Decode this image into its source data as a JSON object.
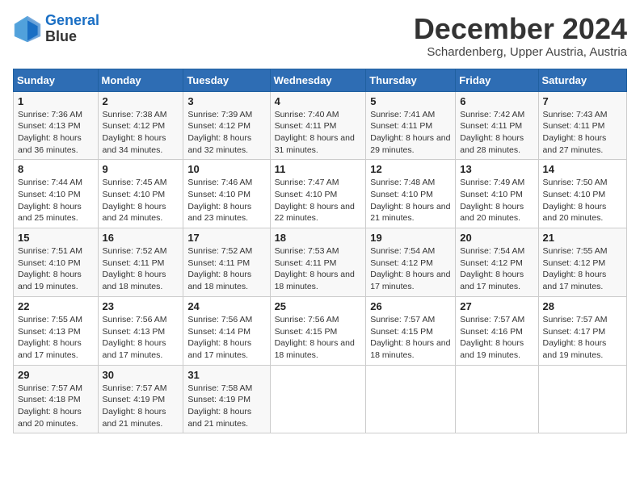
{
  "logo": {
    "line1": "General",
    "line2": "Blue"
  },
  "title": "December 2024",
  "subtitle": "Schardenberg, Upper Austria, Austria",
  "days_of_week": [
    "Sunday",
    "Monday",
    "Tuesday",
    "Wednesday",
    "Thursday",
    "Friday",
    "Saturday"
  ],
  "weeks": [
    [
      {
        "day": "1",
        "sunrise": "Sunrise: 7:36 AM",
        "sunset": "Sunset: 4:13 PM",
        "daylight": "Daylight: 8 hours and 36 minutes."
      },
      {
        "day": "2",
        "sunrise": "Sunrise: 7:38 AM",
        "sunset": "Sunset: 4:12 PM",
        "daylight": "Daylight: 8 hours and 34 minutes."
      },
      {
        "day": "3",
        "sunrise": "Sunrise: 7:39 AM",
        "sunset": "Sunset: 4:12 PM",
        "daylight": "Daylight: 8 hours and 32 minutes."
      },
      {
        "day": "4",
        "sunrise": "Sunrise: 7:40 AM",
        "sunset": "Sunset: 4:11 PM",
        "daylight": "Daylight: 8 hours and 31 minutes."
      },
      {
        "day": "5",
        "sunrise": "Sunrise: 7:41 AM",
        "sunset": "Sunset: 4:11 PM",
        "daylight": "Daylight: 8 hours and 29 minutes."
      },
      {
        "day": "6",
        "sunrise": "Sunrise: 7:42 AM",
        "sunset": "Sunset: 4:11 PM",
        "daylight": "Daylight: 8 hours and 28 minutes."
      },
      {
        "day": "7",
        "sunrise": "Sunrise: 7:43 AM",
        "sunset": "Sunset: 4:11 PM",
        "daylight": "Daylight: 8 hours and 27 minutes."
      }
    ],
    [
      {
        "day": "8",
        "sunrise": "Sunrise: 7:44 AM",
        "sunset": "Sunset: 4:10 PM",
        "daylight": "Daylight: 8 hours and 25 minutes."
      },
      {
        "day": "9",
        "sunrise": "Sunrise: 7:45 AM",
        "sunset": "Sunset: 4:10 PM",
        "daylight": "Daylight: 8 hours and 24 minutes."
      },
      {
        "day": "10",
        "sunrise": "Sunrise: 7:46 AM",
        "sunset": "Sunset: 4:10 PM",
        "daylight": "Daylight: 8 hours and 23 minutes."
      },
      {
        "day": "11",
        "sunrise": "Sunrise: 7:47 AM",
        "sunset": "Sunset: 4:10 PM",
        "daylight": "Daylight: 8 hours and 22 minutes."
      },
      {
        "day": "12",
        "sunrise": "Sunrise: 7:48 AM",
        "sunset": "Sunset: 4:10 PM",
        "daylight": "Daylight: 8 hours and 21 minutes."
      },
      {
        "day": "13",
        "sunrise": "Sunrise: 7:49 AM",
        "sunset": "Sunset: 4:10 PM",
        "daylight": "Daylight: 8 hours and 20 minutes."
      },
      {
        "day": "14",
        "sunrise": "Sunrise: 7:50 AM",
        "sunset": "Sunset: 4:10 PM",
        "daylight": "Daylight: 8 hours and 20 minutes."
      }
    ],
    [
      {
        "day": "15",
        "sunrise": "Sunrise: 7:51 AM",
        "sunset": "Sunset: 4:10 PM",
        "daylight": "Daylight: 8 hours and 19 minutes."
      },
      {
        "day": "16",
        "sunrise": "Sunrise: 7:52 AM",
        "sunset": "Sunset: 4:11 PM",
        "daylight": "Daylight: 8 hours and 18 minutes."
      },
      {
        "day": "17",
        "sunrise": "Sunrise: 7:52 AM",
        "sunset": "Sunset: 4:11 PM",
        "daylight": "Daylight: 8 hours and 18 minutes."
      },
      {
        "day": "18",
        "sunrise": "Sunrise: 7:53 AM",
        "sunset": "Sunset: 4:11 PM",
        "daylight": "Daylight: 8 hours and 18 minutes."
      },
      {
        "day": "19",
        "sunrise": "Sunrise: 7:54 AM",
        "sunset": "Sunset: 4:12 PM",
        "daylight": "Daylight: 8 hours and 17 minutes."
      },
      {
        "day": "20",
        "sunrise": "Sunrise: 7:54 AM",
        "sunset": "Sunset: 4:12 PM",
        "daylight": "Daylight: 8 hours and 17 minutes."
      },
      {
        "day": "21",
        "sunrise": "Sunrise: 7:55 AM",
        "sunset": "Sunset: 4:12 PM",
        "daylight": "Daylight: 8 hours and 17 minutes."
      }
    ],
    [
      {
        "day": "22",
        "sunrise": "Sunrise: 7:55 AM",
        "sunset": "Sunset: 4:13 PM",
        "daylight": "Daylight: 8 hours and 17 minutes."
      },
      {
        "day": "23",
        "sunrise": "Sunrise: 7:56 AM",
        "sunset": "Sunset: 4:13 PM",
        "daylight": "Daylight: 8 hours and 17 minutes."
      },
      {
        "day": "24",
        "sunrise": "Sunrise: 7:56 AM",
        "sunset": "Sunset: 4:14 PM",
        "daylight": "Daylight: 8 hours and 17 minutes."
      },
      {
        "day": "25",
        "sunrise": "Sunrise: 7:56 AM",
        "sunset": "Sunset: 4:15 PM",
        "daylight": "Daylight: 8 hours and 18 minutes."
      },
      {
        "day": "26",
        "sunrise": "Sunrise: 7:57 AM",
        "sunset": "Sunset: 4:15 PM",
        "daylight": "Daylight: 8 hours and 18 minutes."
      },
      {
        "day": "27",
        "sunrise": "Sunrise: 7:57 AM",
        "sunset": "Sunset: 4:16 PM",
        "daylight": "Daylight: 8 hours and 19 minutes."
      },
      {
        "day": "28",
        "sunrise": "Sunrise: 7:57 AM",
        "sunset": "Sunset: 4:17 PM",
        "daylight": "Daylight: 8 hours and 19 minutes."
      }
    ],
    [
      {
        "day": "29",
        "sunrise": "Sunrise: 7:57 AM",
        "sunset": "Sunset: 4:18 PM",
        "daylight": "Daylight: 8 hours and 20 minutes."
      },
      {
        "day": "30",
        "sunrise": "Sunrise: 7:57 AM",
        "sunset": "Sunset: 4:19 PM",
        "daylight": "Daylight: 8 hours and 21 minutes."
      },
      {
        "day": "31",
        "sunrise": "Sunrise: 7:58 AM",
        "sunset": "Sunset: 4:19 PM",
        "daylight": "Daylight: 8 hours and 21 minutes."
      },
      {
        "day": "",
        "sunrise": "",
        "sunset": "",
        "daylight": ""
      },
      {
        "day": "",
        "sunrise": "",
        "sunset": "",
        "daylight": ""
      },
      {
        "day": "",
        "sunrise": "",
        "sunset": "",
        "daylight": ""
      },
      {
        "day": "",
        "sunrise": "",
        "sunset": "",
        "daylight": ""
      }
    ]
  ]
}
